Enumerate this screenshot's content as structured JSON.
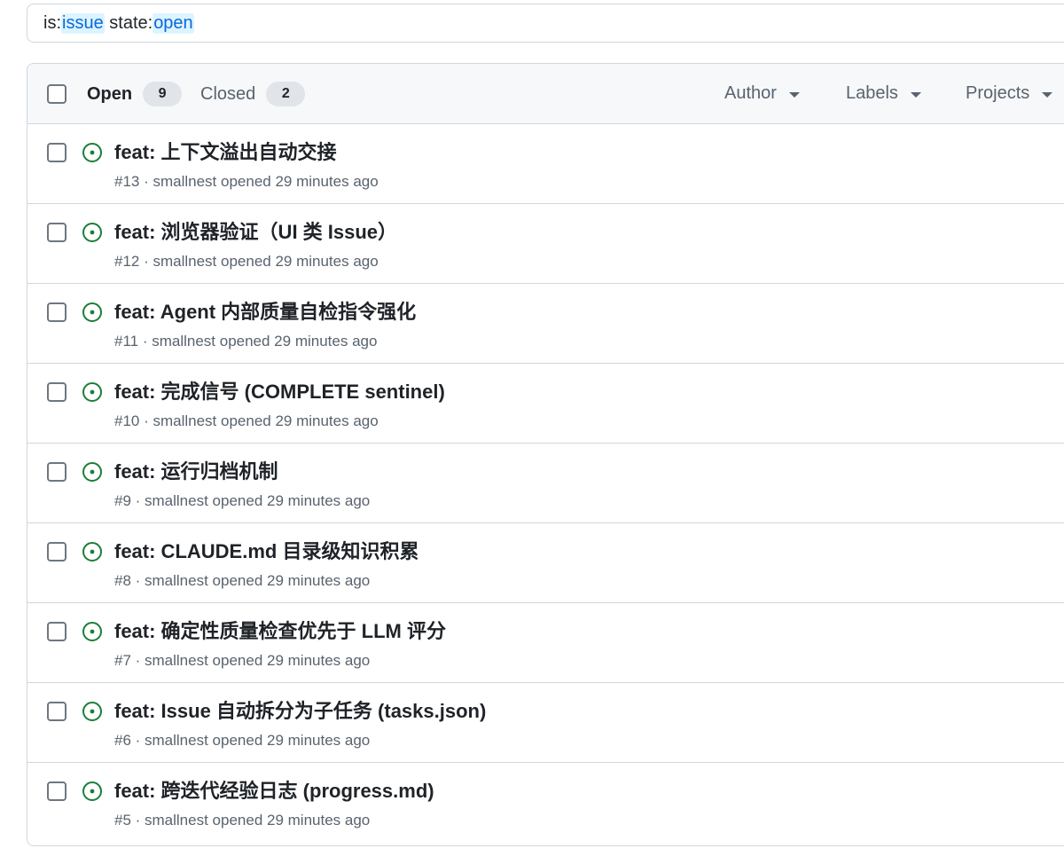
{
  "search": {
    "tokens": [
      {
        "text": "is:",
        "qualifier": false
      },
      {
        "text": "issue",
        "qualifier": true
      },
      {
        "text": " state:",
        "qualifier": false
      },
      {
        "text": "open",
        "qualifier": true
      }
    ]
  },
  "header": {
    "open_label": "Open",
    "open_count": "9",
    "closed_label": "Closed",
    "closed_count": "2",
    "filters": {
      "author": "Author",
      "labels": "Labels",
      "projects": "Projects"
    }
  },
  "colors": {
    "open_icon": "#1a7f37",
    "qualifier": "#0969da"
  },
  "issues": [
    {
      "title": "feat: 上下文溢出自动交接",
      "meta": "#13 · smallnest opened 29 minutes ago",
      "icon": "issue-opened-icon"
    },
    {
      "title": "feat: 浏览器验证（UI 类 Issue）",
      "meta": "#12 · smallnest opened 29 minutes ago",
      "icon": "issue-opened-icon"
    },
    {
      "title": "feat: Agent 内部质量自检指令强化",
      "meta": "#11 · smallnest opened 29 minutes ago",
      "icon": "issue-opened-icon"
    },
    {
      "title": "feat: 完成信号 (COMPLETE sentinel)",
      "meta": "#10 · smallnest opened 29 minutes ago",
      "icon": "issue-opened-icon"
    },
    {
      "title": "feat: 运行归档机制",
      "meta": "#9 · smallnest opened 29 minutes ago",
      "icon": "issue-opened-icon"
    },
    {
      "title": "feat: CLAUDE.md 目录级知识积累",
      "meta": "#8 · smallnest opened 29 minutes ago",
      "icon": "issue-opened-icon"
    },
    {
      "title": "feat: 确定性质量检查优先于 LLM 评分",
      "meta": "#7 · smallnest opened 29 minutes ago",
      "icon": "issue-opened-icon"
    },
    {
      "title": "feat: Issue 自动拆分为子任务 (tasks.json)",
      "meta": "#6 · smallnest opened 29 minutes ago",
      "icon": "issue-opened-icon"
    },
    {
      "title": "feat: 跨迭代经验日志 (progress.md)",
      "meta": "#5 · smallnest opened 29 minutes ago",
      "icon": "issue-opened-icon"
    }
  ]
}
